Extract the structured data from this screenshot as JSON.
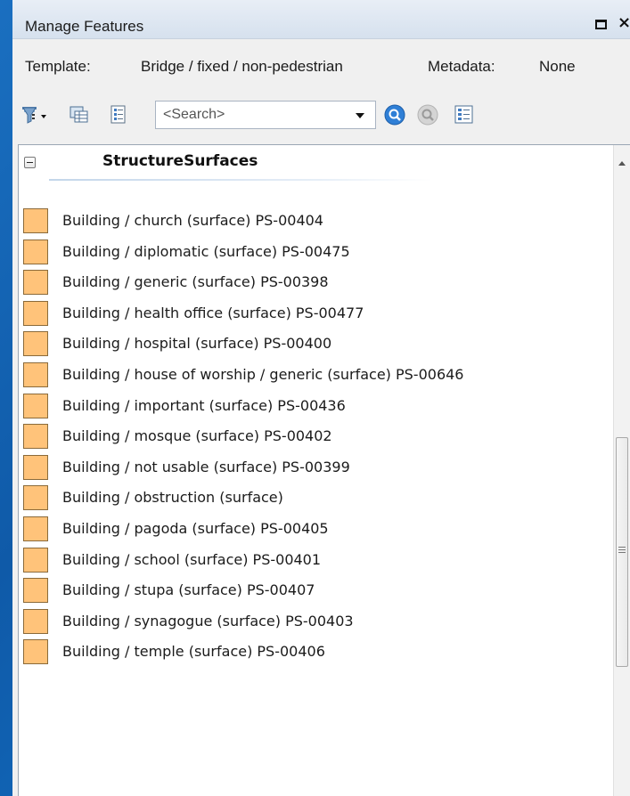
{
  "window": {
    "title": "Manage Features",
    "restore_label": "",
    "close_label": "×"
  },
  "template_row": {
    "template_label": "Template:",
    "template_value": "Bridge / fixed / non-pedestrian",
    "metadata_label": "Metadata:",
    "metadata_value": "None"
  },
  "toolbar": {
    "search_placeholder": "<Search>"
  },
  "group": {
    "title": "StructureSurfaces"
  },
  "swatch_color": "#ffc37a",
  "items": [
    "Building / church (surface) PS-00404",
    "Building / diplomatic (surface) PS-00475",
    "Building / generic (surface) PS-00398",
    "Building / health office (surface) PS-00477",
    "Building / hospital (surface) PS-00400",
    "Building / house of worship / generic (surface) PS-00646",
    "Building / important (surface) PS-00436",
    "Building / mosque (surface) PS-00402",
    "Building / not usable (surface) PS-00399",
    "Building / obstruction (surface)",
    "Building / pagoda (surface) PS-00405",
    "Building / school (surface) PS-00401",
    "Building / stupa (surface) PS-00407",
    "Building / synagogue (surface) PS-00403",
    "Building / temple (surface) PS-00406"
  ]
}
